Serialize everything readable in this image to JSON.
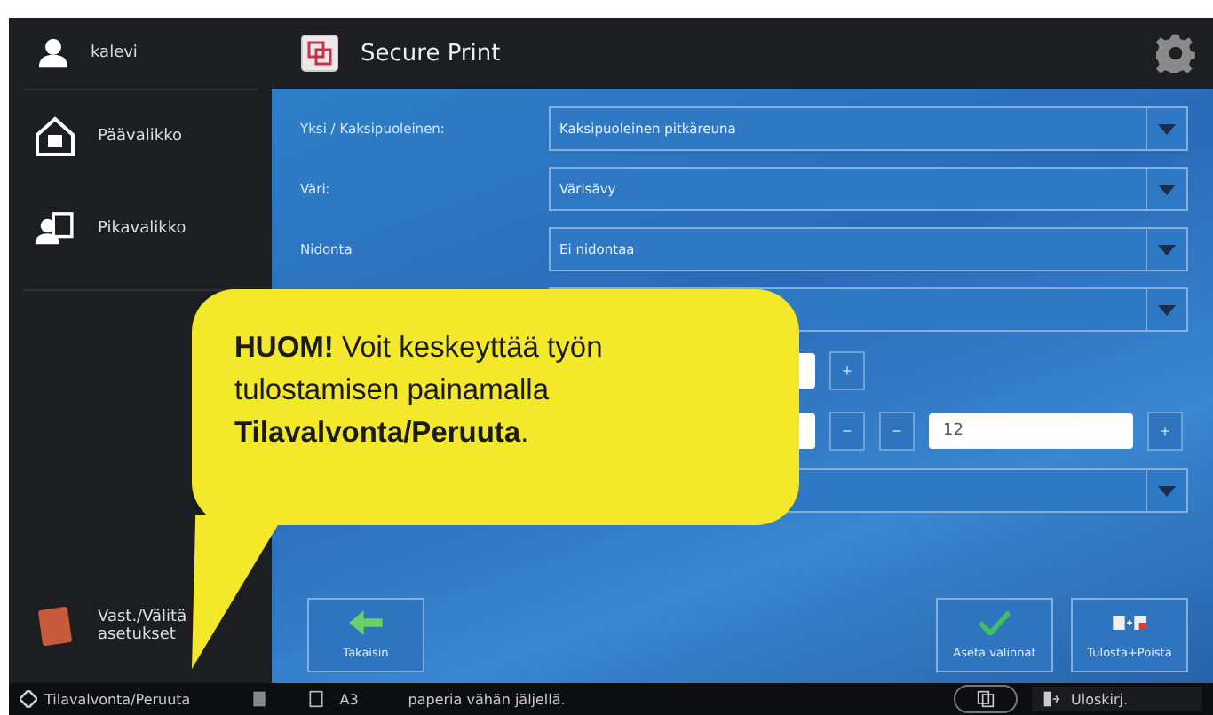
{
  "sidebar": {
    "user": "kalevi",
    "items": [
      {
        "label": "Päävalikko"
      },
      {
        "label": "Pikavalikko"
      }
    ],
    "bottom_item": "Vast./Välitä asetukset"
  },
  "header": {
    "title": "Secure Print"
  },
  "rows": [
    {
      "kind": "dropdown",
      "label": "Yksi / Kaksipuoleinen:",
      "value": "Kaksipuoleinen pitkäreuna"
    },
    {
      "kind": "dropdown",
      "label": "Väri:",
      "value": "Värisävy"
    },
    {
      "kind": "dropdown",
      "label": "Nidonta",
      "value": "Ei nidontaa"
    },
    {
      "kind": "dropdown"
    },
    {
      "kind": "counter",
      "parts": [
        {
          "kind": "field"
        },
        {
          "kind": "button",
          "text": "+"
        }
      ]
    },
    {
      "kind": "counter",
      "parts": [
        {
          "kind": "field"
        },
        {
          "kind": "button",
          "text": "−"
        },
        {
          "kind": "button",
          "text": "−"
        },
        {
          "kind": "field",
          "value": "12"
        },
        {
          "kind": "button",
          "text": "+"
        }
      ]
    },
    {
      "kind": "dropdown"
    }
  ],
  "actions": {
    "back": "Takaisin",
    "apply": "Aseta valinnat",
    "print_delete": "Tulosta+Poista"
  },
  "status_bar": {
    "monitor": "Tilavalvonta/Peruuta",
    "paper_size": "A3",
    "message": "paperia vähän jäljellä.",
    "logout": "Uloskirj."
  },
  "callout": {
    "text": "**HUOM!** Voit keskeyttää työn tulostamisen painamalla **Tilavalvonta/Peruuta**."
  }
}
